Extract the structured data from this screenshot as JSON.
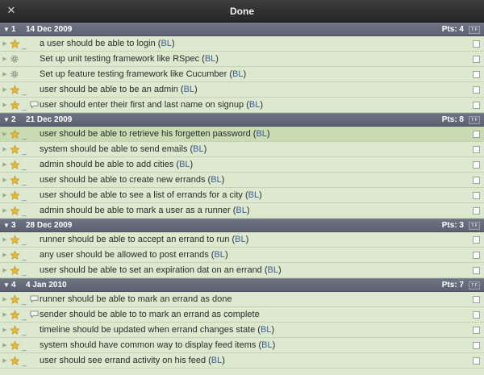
{
  "window": {
    "title": "Done",
    "close_glyph": "✕"
  },
  "icons": {
    "star": "star-icon",
    "gear": "gear-icon",
    "comment": "comment-icon"
  },
  "colors": {
    "star": "#e8b92c",
    "gear": "#8f9488",
    "owner": "#3a5f9a",
    "header": "#646a7a",
    "row": "#dde9cf",
    "selected_row": "#c9dbb3"
  },
  "iterations": [
    {
      "number": "1",
      "date": "14 Dec 2009",
      "points": "Pts: 4",
      "tf_label": "T F",
      "stories": [
        {
          "type": "feature",
          "estimate": "_",
          "has_comment": false,
          "text": "a user should be able to login (",
          "owner": "BL",
          "close": ")"
        },
        {
          "type": "chore",
          "estimate": "",
          "has_comment": false,
          "text": "Set up unit testing framework like RSpec (",
          "owner": "BL",
          "close": ")"
        },
        {
          "type": "chore",
          "estimate": "",
          "has_comment": false,
          "text": "Set up feature testing framework like Cucumber (",
          "owner": "BL",
          "close": ")"
        },
        {
          "type": "feature",
          "estimate": "_",
          "has_comment": false,
          "text": "user should be able to be an admin (",
          "owner": "BL",
          "close": ")"
        },
        {
          "type": "feature",
          "estimate": "_",
          "has_comment": true,
          "text": "user should enter their first and last name on signup (",
          "owner": "BL",
          "close": ")"
        }
      ]
    },
    {
      "number": "2",
      "date": "21 Dec 2009",
      "points": "Pts: 8",
      "tf_label": "T F",
      "stories": [
        {
          "type": "feature",
          "estimate": "_",
          "has_comment": false,
          "selected": true,
          "text": "user should be able to retrieve his forgetten password (",
          "owner": "BL",
          "close": ")"
        },
        {
          "type": "feature",
          "estimate": "_",
          "has_comment": false,
          "text": "system should be able to send emails (",
          "owner": "BL",
          "close": ")"
        },
        {
          "type": "feature",
          "estimate": "_",
          "has_comment": false,
          "text": "admin should be able to add cities (",
          "owner": "BL",
          "close": ")"
        },
        {
          "type": "feature",
          "estimate": "_",
          "has_comment": false,
          "text": "user should be able to create new errands (",
          "owner": "BL",
          "close": ")"
        },
        {
          "type": "feature",
          "estimate": "_",
          "has_comment": false,
          "text": "user should be able to see a list of errands for a city (",
          "owner": "BL",
          "close": ")"
        },
        {
          "type": "feature",
          "estimate": "_",
          "has_comment": false,
          "text": "admin should be able to mark a user as a runner (",
          "owner": "BL",
          "close": ")"
        }
      ]
    },
    {
      "number": "3",
      "date": "28 Dec 2009",
      "points": "Pts: 3",
      "tf_label": "T F",
      "stories": [
        {
          "type": "feature",
          "estimate": "_",
          "has_comment": false,
          "text": "runner should be able to accept an errand to run (",
          "owner": "BL",
          "close": ")"
        },
        {
          "type": "feature",
          "estimate": "_",
          "has_comment": false,
          "text": "any user should be allowed to post errands (",
          "owner": "BL",
          "close": ")"
        },
        {
          "type": "feature",
          "estimate": "_",
          "has_comment": false,
          "text": "user should be able to set an expiration dat on an errand (",
          "owner": "BL",
          "close": ")"
        }
      ]
    },
    {
      "number": "4",
      "date": "4 Jan 2010",
      "points": "Pts: 7",
      "tf_label": "T F",
      "stories": [
        {
          "type": "feature",
          "estimate": "_",
          "has_comment": true,
          "text": "runner should be able to mark an errand as done",
          "owner": "",
          "close": ""
        },
        {
          "type": "feature",
          "estimate": "_",
          "has_comment": true,
          "text": "sender should be able to to mark an errand as complete",
          "owner": "",
          "close": ""
        },
        {
          "type": "feature",
          "estimate": "_",
          "has_comment": false,
          "text": "timeline should be updated when errand changes state (",
          "owner": "BL",
          "close": ")"
        },
        {
          "type": "feature",
          "estimate": "_",
          "has_comment": false,
          "text": "system should have common way to display feed items (",
          "owner": "BL",
          "close": ")"
        },
        {
          "type": "feature",
          "estimate": "_",
          "has_comment": false,
          "text": "user should see errand activity on his feed (",
          "owner": "BL",
          "close": ")"
        }
      ]
    }
  ]
}
